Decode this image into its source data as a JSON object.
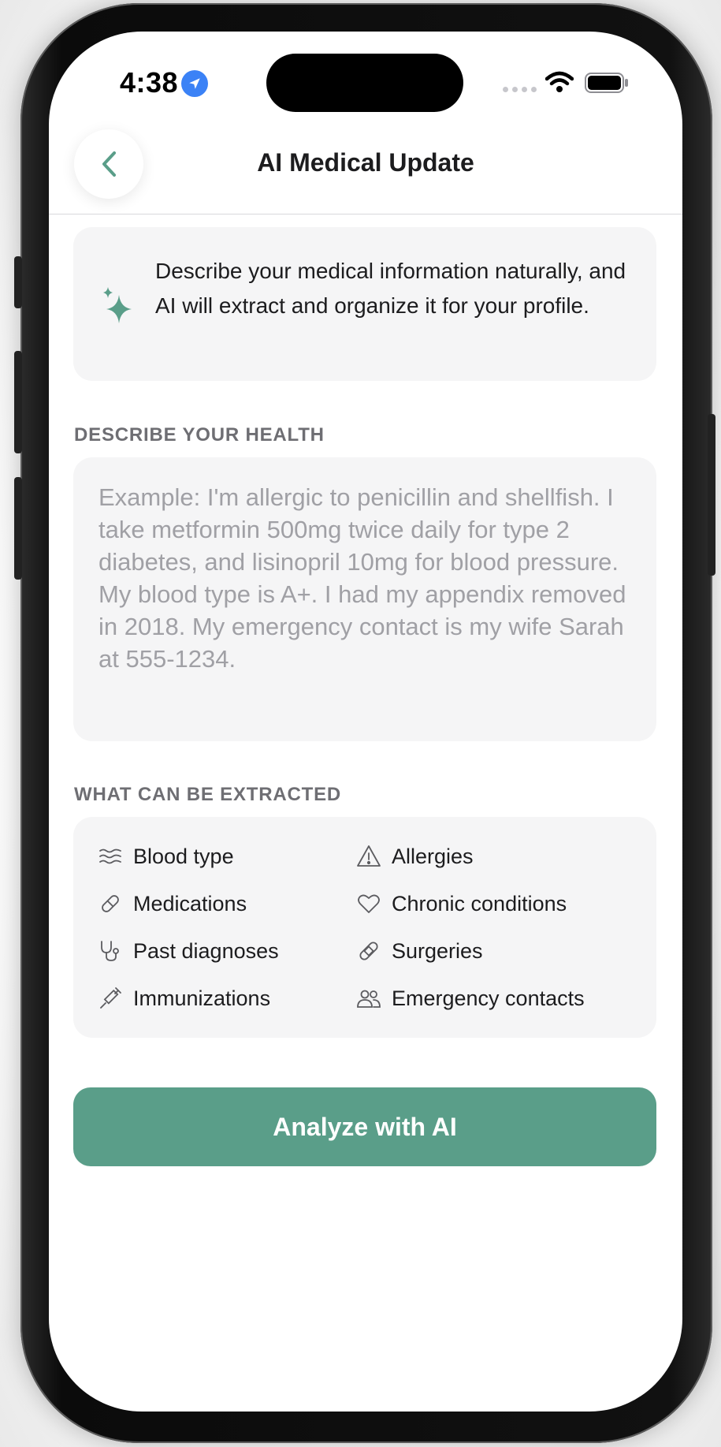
{
  "status_bar": {
    "time": "4:38"
  },
  "header": {
    "title": "AI Medical Update"
  },
  "info_card": {
    "text": "Describe your medical information naturally, and AI will extract and organize it for your profile."
  },
  "describe_section": {
    "label": "DESCRIBE YOUR HEALTH",
    "placeholder": "Example: I'm allergic to penicillin and shellfish. I take metformin 500mg twice daily for type 2 diabetes, and lisinopril 10mg for blood pressure. My blood type is A+. I had my appendix removed in 2018. My emergency contact is my wife Sarah at 555-1234.",
    "value": ""
  },
  "extract_section": {
    "label": "WHAT CAN BE EXTRACTED",
    "items": [
      {
        "label": "Blood type",
        "icon": "waves-icon"
      },
      {
        "label": "Allergies",
        "icon": "warning-icon"
      },
      {
        "label": "Medications",
        "icon": "pill-icon"
      },
      {
        "label": "Chronic conditions",
        "icon": "heart-icon"
      },
      {
        "label": "Past diagnoses",
        "icon": "stethoscope-icon"
      },
      {
        "label": "Surgeries",
        "icon": "bandage-icon"
      },
      {
        "label": "Immunizations",
        "icon": "syringe-icon"
      },
      {
        "label": "Emergency contacts",
        "icon": "people-icon"
      }
    ]
  },
  "actions": {
    "analyze_label": "Analyze with AI"
  },
  "colors": {
    "accent": "#5a9e89",
    "card_bg": "#f5f5f6",
    "location_badge": "#3b82f6"
  }
}
